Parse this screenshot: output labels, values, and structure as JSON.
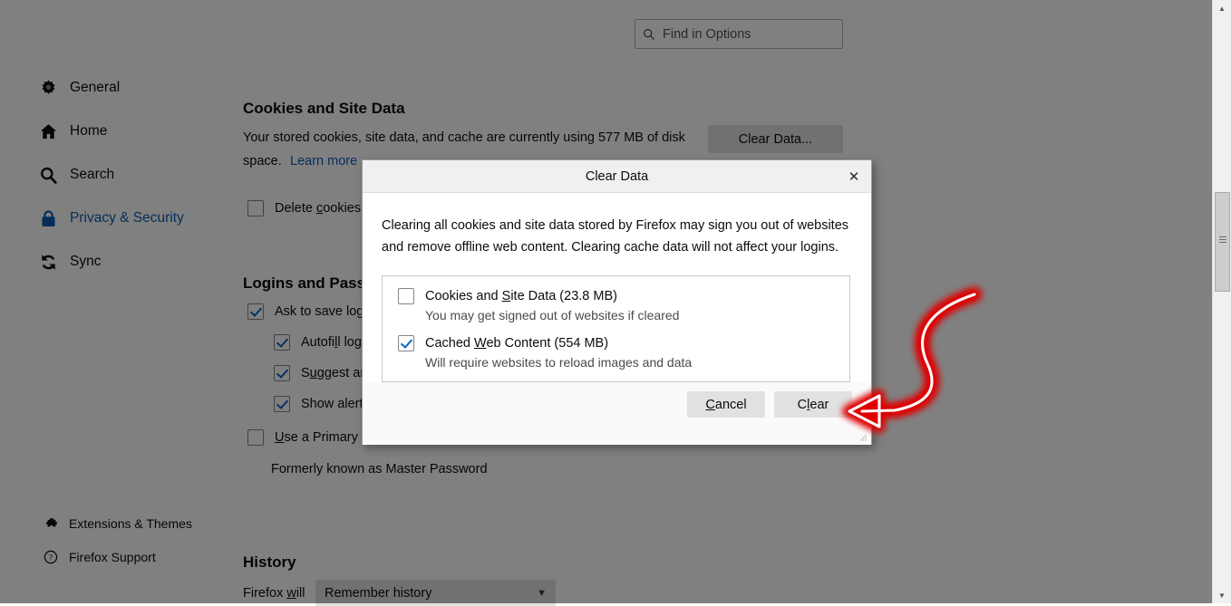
{
  "search": {
    "placeholder": "Find in Options",
    "value": "",
    "icon": "search-icon"
  },
  "sidebar": {
    "items": [
      {
        "label": "General",
        "icon": "gear-icon",
        "active": false
      },
      {
        "label": "Home",
        "icon": "home-icon",
        "active": false
      },
      {
        "label": "Search",
        "icon": "search-icon",
        "active": false
      },
      {
        "label": "Privacy & Security",
        "icon": "lock-icon",
        "active": true
      },
      {
        "label": "Sync",
        "icon": "sync-icon",
        "active": false
      }
    ],
    "footer_items": [
      {
        "label": "Extensions & Themes",
        "icon": "puzzle-icon"
      },
      {
        "label": "Firefox Support",
        "icon": "question-circle-icon"
      }
    ]
  },
  "main": {
    "cookies_section": {
      "title": "Cookies and Site Data",
      "description_line1": "Your stored cookies, site data, and cache are currently using 577 MB of disk",
      "description_line2": "space.",
      "learn_more": "Learn more",
      "clear_data_button": "Clear Data...",
      "delete_cookies_label": "Delete cookies",
      "delete_cookies_checked": false
    },
    "logins_section": {
      "title": "Logins and Passw",
      "rows": [
        {
          "label": "Ask to save log",
          "checked": true,
          "indent": 0
        },
        {
          "label": "Autofill log",
          "checked": true,
          "indent": 1
        },
        {
          "label": "Suggest an",
          "checked": true,
          "indent": 1
        },
        {
          "label": "Show alert",
          "checked": true,
          "indent": 1
        },
        {
          "label": "Use a Primary P",
          "checked": false,
          "indent": 0
        }
      ],
      "note": "Formerly known as Master Password"
    },
    "history_section": {
      "title": "History",
      "prefix_label": "Firefox will",
      "select_value": "Remember history",
      "select_chevron": "chevron-down-icon"
    }
  },
  "dialog": {
    "title": "Clear Data",
    "close_icon": "close-icon",
    "description": "Clearing all cookies and site data stored by Firefox may sign you out of websites and remove offline web content. Clearing cache data will not affect your logins.",
    "options": [
      {
        "label": "Cookies and Site Data (23.8 MB)",
        "sublabel": "You may get signed out of websites if cleared",
        "checked": false
      },
      {
        "label": "Cached Web Content (554 MB)",
        "sublabel": "Will require websites to reload images and data",
        "checked": true
      }
    ],
    "cancel_label": "Cancel",
    "clear_label": "Clear",
    "resize_grip": "resize-grip-icon"
  },
  "scrollbar": {
    "up_arrow": "triangle-up-icon",
    "down_arrow": "triangle-down-icon"
  },
  "annotation": {
    "type": "arrow-annotation",
    "points_to": "Clear",
    "color": "#e00000"
  }
}
